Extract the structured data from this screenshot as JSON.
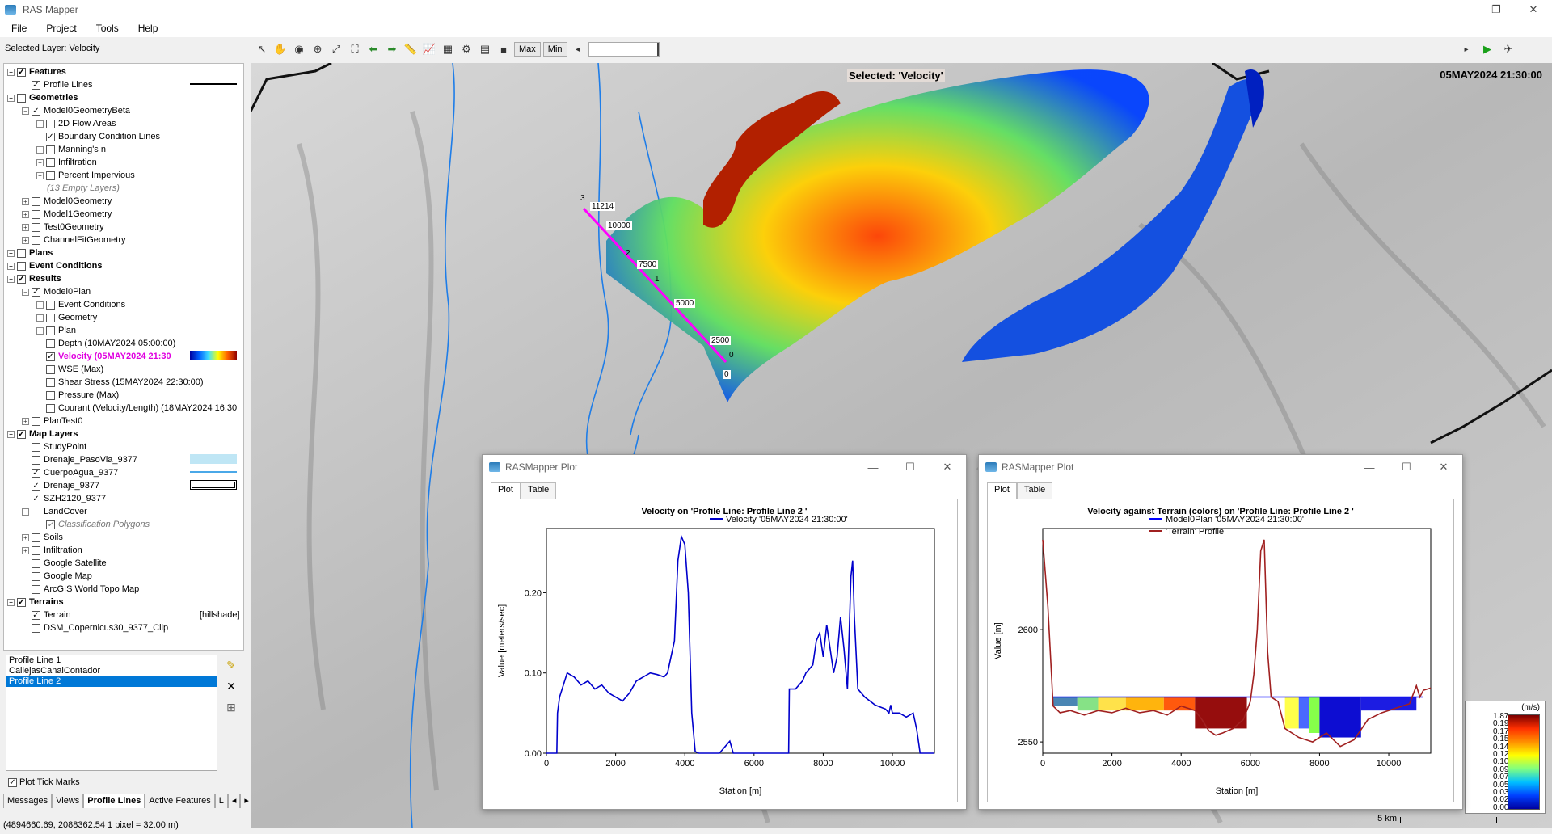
{
  "window": {
    "title": "RAS Mapper",
    "min": "—",
    "max": "❐",
    "close": "✕"
  },
  "menu": [
    "File",
    "Project",
    "Tools",
    "Help"
  ],
  "selected_layer": "Selected Layer: Velocity",
  "toolbar": {
    "max_label": "Max",
    "min_label": "Min"
  },
  "tree": [
    {
      "lvl": 0,
      "exp": "−",
      "chk": "✓",
      "label": "Features",
      "bold": true
    },
    {
      "lvl": 1,
      "exp": "",
      "chk": "✓",
      "label": "Profile Lines",
      "legend": "line-black"
    },
    {
      "lvl": 0,
      "exp": "−",
      "chk": "",
      "label": "Geometries",
      "bold": true
    },
    {
      "lvl": 1,
      "exp": "−",
      "chk": "✓",
      "label": "Model0GeometryBeta"
    },
    {
      "lvl": 2,
      "exp": "+",
      "chk": "",
      "label": "2D Flow Areas"
    },
    {
      "lvl": 2,
      "exp": "",
      "chk": "✓",
      "label": "Boundary Condition Lines"
    },
    {
      "lvl": 2,
      "exp": "+",
      "chk": "",
      "label": "Manning's n"
    },
    {
      "lvl": 2,
      "exp": "+",
      "chk": "",
      "label": "Infiltration"
    },
    {
      "lvl": 2,
      "exp": "+",
      "chk": "",
      "label": "Percent Impervious"
    },
    {
      "lvl": 2,
      "exp": "",
      "chk": null,
      "label": "(13 Empty Layers)",
      "italic": true
    },
    {
      "lvl": 1,
      "exp": "+",
      "chk": "",
      "label": "Model0Geometry"
    },
    {
      "lvl": 1,
      "exp": "+",
      "chk": "",
      "label": "Model1Geometry"
    },
    {
      "lvl": 1,
      "exp": "+",
      "chk": "",
      "label": "Test0Geometry"
    },
    {
      "lvl": 1,
      "exp": "+",
      "chk": "",
      "label": "ChannelFitGeometry"
    },
    {
      "lvl": 0,
      "exp": "+",
      "chk": "",
      "label": "Plans",
      "bold": true
    },
    {
      "lvl": 0,
      "exp": "+",
      "chk": "",
      "label": "Event Conditions",
      "bold": true
    },
    {
      "lvl": 0,
      "exp": "−",
      "chk": "✓",
      "label": "Results",
      "bold": true
    },
    {
      "lvl": 1,
      "exp": "−",
      "chk": "✓",
      "label": "Model0Plan"
    },
    {
      "lvl": 2,
      "exp": "+",
      "chk": "",
      "label": "Event Conditions"
    },
    {
      "lvl": 2,
      "exp": "+",
      "chk": "",
      "label": "Geometry"
    },
    {
      "lvl": 2,
      "exp": "+",
      "chk": "",
      "label": "Plan"
    },
    {
      "lvl": 2,
      "exp": "",
      "chk": "",
      "label": "Depth (10MAY2024 05:00:00)"
    },
    {
      "lvl": 2,
      "exp": "",
      "chk": "✓",
      "label": "Velocity (05MAY2024 21:30",
      "hl": true,
      "legend": "ramp"
    },
    {
      "lvl": 2,
      "exp": "",
      "chk": "",
      "label": "WSE (Max)"
    },
    {
      "lvl": 2,
      "exp": "",
      "chk": "",
      "label": "Shear Stress (15MAY2024 22:30:00)"
    },
    {
      "lvl": 2,
      "exp": "",
      "chk": "",
      "label": "Pressure (Max)"
    },
    {
      "lvl": 2,
      "exp": "",
      "chk": "",
      "label": "Courant (Velocity/Length) (18MAY2024 16:30"
    },
    {
      "lvl": 1,
      "exp": "+",
      "chk": "",
      "label": "PlanTest0"
    },
    {
      "lvl": 0,
      "exp": "−",
      "chk": "✓",
      "label": "Map Layers",
      "bold": true
    },
    {
      "lvl": 1,
      "exp": "",
      "chk": "",
      "label": "StudyPoint"
    },
    {
      "lvl": 1,
      "exp": "",
      "chk": "",
      "label": "Drenaje_PasoVia_9377",
      "legend": "fill-lightblue"
    },
    {
      "lvl": 1,
      "exp": "",
      "chk": "✓",
      "label": "CuerpoAgua_9377",
      "legend": "line-blue"
    },
    {
      "lvl": 1,
      "exp": "",
      "chk": "✓",
      "label": "Drenaje_9377",
      "legend": "box-double"
    },
    {
      "lvl": 1,
      "exp": "",
      "chk": "✓",
      "label": "SZH2120_9377"
    },
    {
      "lvl": 1,
      "exp": "−",
      "chk": "",
      "label": "LandCover"
    },
    {
      "lvl": 2,
      "exp": "",
      "chk": "✓",
      "label": "Classification Polygons",
      "italic": true
    },
    {
      "lvl": 1,
      "exp": "+",
      "chk": "",
      "label": "Soils"
    },
    {
      "lvl": 1,
      "exp": "+",
      "chk": "",
      "label": "Infiltration"
    },
    {
      "lvl": 1,
      "exp": "",
      "chk": "",
      "label": "Google Satellite"
    },
    {
      "lvl": 1,
      "exp": "",
      "chk": "",
      "label": "Google Map"
    },
    {
      "lvl": 1,
      "exp": "",
      "chk": "",
      "label": "ArcGIS World Topo Map"
    },
    {
      "lvl": 0,
      "exp": "−",
      "chk": "✓",
      "label": "Terrains",
      "bold": true
    },
    {
      "lvl": 1,
      "exp": "",
      "chk": "✓",
      "label": "Terrain",
      "right": "[hillshade]"
    },
    {
      "lvl": 1,
      "exp": "",
      "chk": "",
      "label": "DSM_Copernicus30_9377_Clip"
    }
  ],
  "profile_lines": [
    "Profile Line 1",
    "CallejasCanalContador",
    "Profile Line 2"
  ],
  "plot_tick_marks": "Plot Tick Marks",
  "side_tabs": [
    "Messages",
    "Views",
    "Profile Lines",
    "Active Features",
    "L"
  ],
  "status": "(4894660.69, 2088362.54  1 pixel = 32.00 m)",
  "map": {
    "selected_label": "Selected: 'Velocity'",
    "date": "05MAY2024 21:30:00",
    "scale": "5 km",
    "stations": [
      "11214",
      "10000",
      "7500",
      "5000",
      "2500",
      "0"
    ],
    "markers": [
      "3",
      "2",
      "1",
      "0"
    ],
    "colorbar_unit": "(m/s)",
    "colorbar_labels": [
      "1.87",
      "0.19",
      "0.17",
      "0.15",
      "0.14",
      "0.12",
      "0.10",
      "0.09",
      "0.07",
      "0.05",
      "0.03",
      "0.02",
      "0.00"
    ]
  },
  "plot1": {
    "win_title": "RASMapper Plot",
    "tabs": [
      "Plot",
      "Table"
    ],
    "chart_data": {
      "type": "line",
      "title": "Velocity on 'Profile Line: Profile Line 2 '",
      "xlabel": "Station [m]",
      "ylabel": "Value [meters/sec]",
      "xlim": [
        0,
        11214
      ],
      "ylim": [
        0,
        0.28
      ],
      "xticks": [
        "0",
        "2000",
        "4000",
        "6000",
        "8000",
        "10000"
      ],
      "yticks": [
        "0.00",
        "0.10",
        "0.20"
      ],
      "legend_position": "top-right",
      "series": [
        {
          "name": "Velocity '05MAY2024 21:30:00'",
          "color": "#0000cc",
          "x": [
            0,
            300,
            320,
            380,
            600,
            800,
            1000,
            1200,
            1400,
            1600,
            1800,
            2000,
            2200,
            2400,
            2600,
            2800,
            3000,
            3200,
            3400,
            3500,
            3700,
            3800,
            3900,
            4000,
            4100,
            4200,
            4300,
            4400,
            4500,
            5000,
            5200,
            5300,
            5400,
            5600,
            6000,
            6500,
            6900,
            7000,
            7020,
            7200,
            7400,
            7500,
            7700,
            7800,
            7900,
            8000,
            8100,
            8200,
            8300,
            8400,
            8500,
            8600,
            8700,
            8800,
            8850,
            8900,
            9000,
            9200,
            9500,
            9800,
            9900,
            9950,
            10000,
            10200,
            10400,
            10600,
            10700,
            10800,
            11214
          ],
          "y": [
            0,
            0,
            0.05,
            0.07,
            0.1,
            0.095,
            0.085,
            0.09,
            0.08,
            0.085,
            0.075,
            0.07,
            0.065,
            0.075,
            0.09,
            0.095,
            0.1,
            0.098,
            0.095,
            0.1,
            0.14,
            0.24,
            0.27,
            0.26,
            0.2,
            0.05,
            0.002,
            0,
            0,
            0,
            0.01,
            0.015,
            0,
            0,
            0,
            0,
            0,
            0,
            0.08,
            0.08,
            0.09,
            0.1,
            0.11,
            0.14,
            0.15,
            0.12,
            0.16,
            0.13,
            0.1,
            0.12,
            0.17,
            0.13,
            0.08,
            0.22,
            0.24,
            0.17,
            0.08,
            0.07,
            0.06,
            0.055,
            0.05,
            0.06,
            0.05,
            0.05,
            0.045,
            0.05,
            0.03,
            0,
            0
          ]
        }
      ]
    }
  },
  "plot2": {
    "win_title": "RASMapper Plot",
    "tabs": [
      "Plot",
      "Table"
    ],
    "chart_data": {
      "type": "line",
      "title": "Velocity against Terrain (colors) on 'Profile Line: Profile Line 2 '",
      "xlabel": "Station [m]",
      "ylabel": "Value [m]",
      "xlim": [
        0,
        11214
      ],
      "ylim": [
        2545,
        2645
      ],
      "xticks": [
        "0",
        "2000",
        "4000",
        "6000",
        "8000",
        "10000"
      ],
      "yticks": [
        "2550",
        "2600"
      ],
      "legend_position": "top",
      "series": [
        {
          "name": "Model0Plan '05MAY2024 21:30:00'",
          "color": "#0000ff",
          "x": [
            300,
            11000
          ],
          "y": [
            2570,
            2570
          ]
        },
        {
          "name": "'Terrain' Profile",
          "color": "#a02020",
          "x": [
            0,
            150,
            300,
            500,
            800,
            1200,
            1600,
            2000,
            2400,
            2800,
            3200,
            3600,
            4000,
            4400,
            4600,
            4800,
            5000,
            5200,
            5500,
            5800,
            6000,
            6100,
            6200,
            6300,
            6400,
            6500,
            6600,
            6800,
            7000,
            7400,
            7800,
            8200,
            8600,
            9000,
            9400,
            9800,
            10200,
            10600,
            10800,
            10900,
            11000,
            11214
          ],
          "y": [
            2640,
            2610,
            2566,
            2563,
            2564,
            2562,
            2564,
            2563,
            2565,
            2563,
            2564,
            2562,
            2566,
            2564,
            2560,
            2555,
            2553,
            2554,
            2556,
            2560,
            2568,
            2580,
            2600,
            2635,
            2640,
            2590,
            2570,
            2568,
            2556,
            2552,
            2550,
            2554,
            2548,
            2551,
            2560,
            2563,
            2565,
            2567,
            2575,
            2570,
            2573,
            2574
          ]
        }
      ],
      "fill_segments": [
        {
          "x0": 300,
          "x1": 1000,
          "color": "#4080b0",
          "depth": 4
        },
        {
          "x0": 1000,
          "x1": 1600,
          "color": "#80e080",
          "depth": 6
        },
        {
          "x0": 1600,
          "x1": 2400,
          "color": "#ffe040",
          "depth": 6
        },
        {
          "x0": 2400,
          "x1": 3500,
          "color": "#ffb000",
          "depth": 6
        },
        {
          "x0": 3500,
          "x1": 4400,
          "color": "#ff5000",
          "depth": 6
        },
        {
          "x0": 4400,
          "x1": 5900,
          "color": "#900000",
          "depth": 14
        },
        {
          "x0": 7000,
          "x1": 7400,
          "color": "#ffff40",
          "depth": 14
        },
        {
          "x0": 7400,
          "x1": 7700,
          "color": "#4060ff",
          "depth": 14
        },
        {
          "x0": 7700,
          "x1": 8000,
          "color": "#80ff40",
          "depth": 16
        },
        {
          "x0": 8000,
          "x1": 9200,
          "color": "#0000d0",
          "depth": 18
        },
        {
          "x0": 9200,
          "x1": 10800,
          "color": "#1010e0",
          "depth": 6
        }
      ]
    }
  }
}
